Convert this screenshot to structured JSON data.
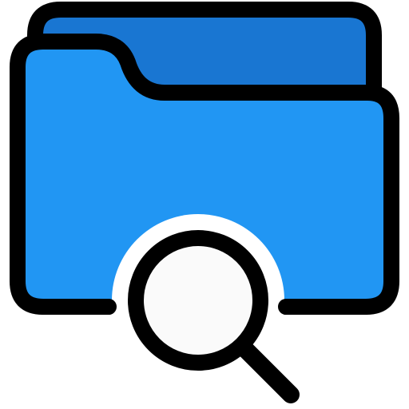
{
  "icon": {
    "name": "folder-search-icon",
    "colors": {
      "outline": "#000000",
      "folder_back": "#1976D2",
      "folder_front": "#2196F3",
      "lens_fill": "#FAFAFA",
      "cutout": "#FFFFFF"
    }
  }
}
